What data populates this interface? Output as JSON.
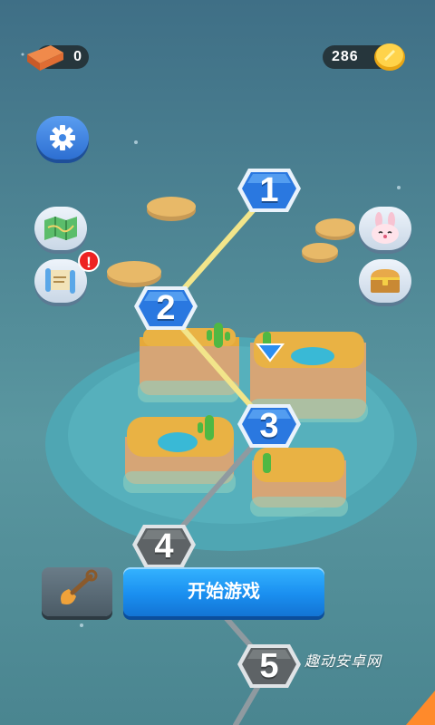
{
  "hud": {
    "bricks": "0",
    "coins": "286"
  },
  "levels": [
    {
      "number": "1",
      "state": "unlocked"
    },
    {
      "number": "2",
      "state": "unlocked"
    },
    {
      "number": "3",
      "state": "current"
    },
    {
      "number": "4",
      "state": "locked"
    },
    {
      "number": "5",
      "state": "locked"
    }
  ],
  "side_buttons": {
    "left": [
      "settings-icon",
      "map-icon",
      "quest-scroll-icon"
    ],
    "right": [
      "bunny-icon",
      "treasure-chest-icon"
    ],
    "alert_mark": "!"
  },
  "start_button": {
    "label": "开始游戏"
  },
  "watermark": "趣动安卓网",
  "colors": {
    "unlocked_node": "#2a78e0",
    "locked_node": "#5e6366",
    "path_unlocked": "#f2e58a",
    "path_locked": "#8f9aa0",
    "start_button": "#1a8ff0"
  }
}
